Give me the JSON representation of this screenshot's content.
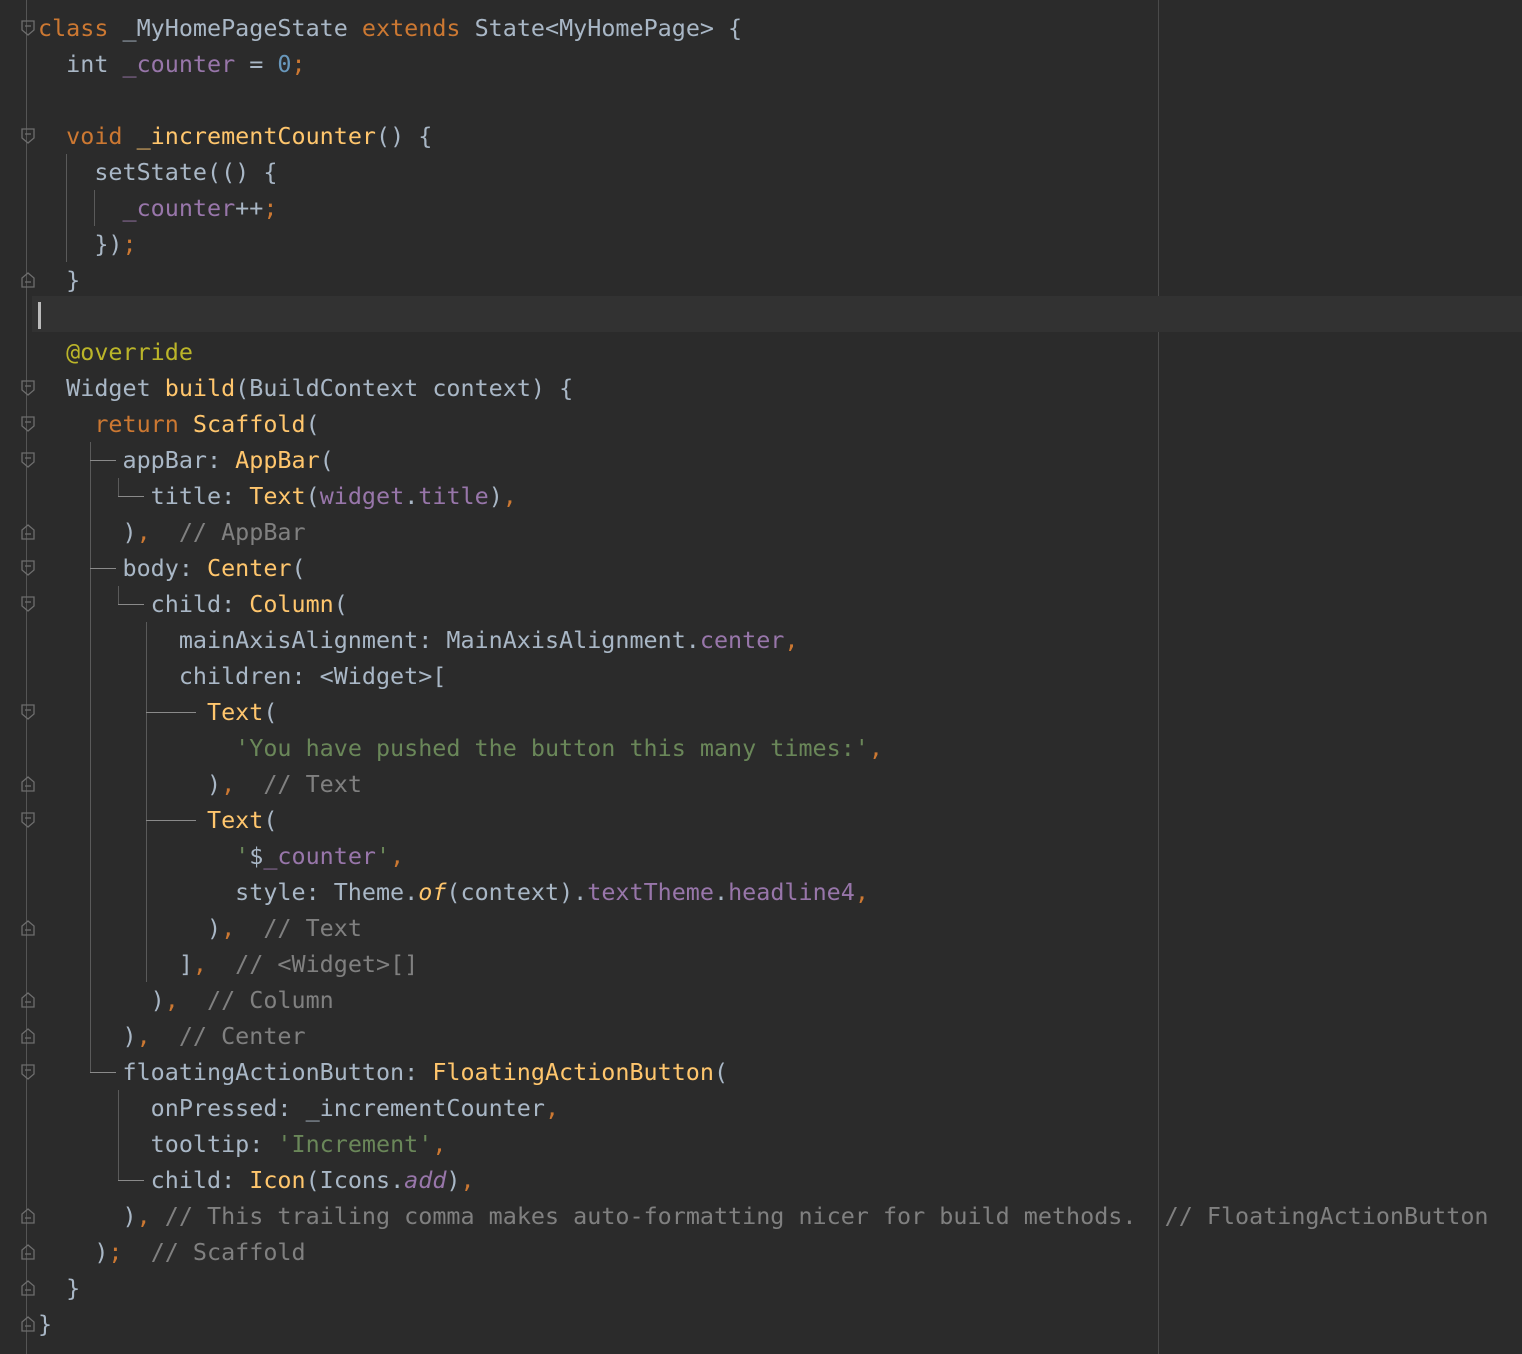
{
  "code_lines": [
    [
      {
        "t": "class ",
        "c": "kw"
      },
      {
        "t": "_MyHomePageState "
      },
      {
        "t": "extends ",
        "c": "kw"
      },
      {
        "t": "State<MyHomePage> {"
      }
    ],
    [
      {
        "t": "  int "
      },
      {
        "t": "_counter",
        "c": "field"
      },
      {
        "t": " = "
      },
      {
        "t": "0",
        "c": "num"
      },
      {
        "t": ";",
        "c": "punc"
      }
    ],
    [],
    [
      {
        "t": "  "
      },
      {
        "t": "void ",
        "c": "kw"
      },
      {
        "t": "_incrementCounter",
        "c": "fn"
      },
      {
        "t": "() {"
      }
    ],
    [
      {
        "t": "    setState(() {"
      }
    ],
    [
      {
        "t": "      "
      },
      {
        "t": "_counter",
        "c": "field"
      },
      {
        "t": "++"
      },
      {
        "t": ";",
        "c": "punc"
      }
    ],
    [
      {
        "t": "    })"
      },
      {
        "t": ";",
        "c": "punc"
      }
    ],
    [
      {
        "t": "  }"
      }
    ],
    [],
    [
      {
        "t": "  "
      },
      {
        "t": "@override",
        "c": "ann"
      }
    ],
    [
      {
        "t": "  Widget "
      },
      {
        "t": "build",
        "c": "fn"
      },
      {
        "t": "(BuildContext context) {"
      }
    ],
    [
      {
        "t": "    "
      },
      {
        "t": "return ",
        "c": "kw"
      },
      {
        "t": "Scaffold",
        "c": "fn"
      },
      {
        "t": "("
      }
    ],
    [
      {
        "t": "      appBar: "
      },
      {
        "t": "AppBar",
        "c": "fn"
      },
      {
        "t": "("
      }
    ],
    [
      {
        "t": "        title: "
      },
      {
        "t": "Text",
        "c": "fn"
      },
      {
        "t": "("
      },
      {
        "t": "widget",
        "c": "field"
      },
      {
        "t": "."
      },
      {
        "t": "title",
        "c": "field"
      },
      {
        "t": ")"
      },
      {
        "t": ",",
        "c": "punc"
      }
    ],
    [
      {
        "t": "      )"
      },
      {
        "t": ",",
        "c": "punc"
      },
      {
        "t": "  "
      },
      {
        "t": "// AppBar",
        "c": "cmt"
      }
    ],
    [
      {
        "t": "      body: "
      },
      {
        "t": "Center",
        "c": "fn"
      },
      {
        "t": "("
      }
    ],
    [
      {
        "t": "        child: "
      },
      {
        "t": "Column",
        "c": "fn"
      },
      {
        "t": "("
      }
    ],
    [
      {
        "t": "          mainAxisAlignment: MainAxisAlignment."
      },
      {
        "t": "center",
        "c": "field"
      },
      {
        "t": ",",
        "c": "punc"
      }
    ],
    [
      {
        "t": "          children: <Widget>["
      }
    ],
    [
      {
        "t": "            "
      },
      {
        "t": "Text",
        "c": "fn"
      },
      {
        "t": "("
      }
    ],
    [
      {
        "t": "              "
      },
      {
        "t": "'You have pushed the button this many times:'",
        "c": "str"
      },
      {
        "t": ",",
        "c": "punc"
      }
    ],
    [
      {
        "t": "            )"
      },
      {
        "t": ",",
        "c": "punc"
      },
      {
        "t": "  "
      },
      {
        "t": "// Text",
        "c": "cmt"
      }
    ],
    [
      {
        "t": "            "
      },
      {
        "t": "Text",
        "c": "fn"
      },
      {
        "t": "("
      }
    ],
    [
      {
        "t": "              "
      },
      {
        "t": "'",
        "c": "str"
      },
      {
        "t": "$"
      },
      {
        "t": "_counter",
        "c": "field"
      },
      {
        "t": "'",
        "c": "str"
      },
      {
        "t": ",",
        "c": "punc"
      }
    ],
    [
      {
        "t": "              style: Theme."
      },
      {
        "t": "of",
        "c": "fn it"
      },
      {
        "t": "(context)."
      },
      {
        "t": "textTheme",
        "c": "field"
      },
      {
        "t": "."
      },
      {
        "t": "headline4",
        "c": "field"
      },
      {
        "t": ",",
        "c": "punc"
      }
    ],
    [
      {
        "t": "            )"
      },
      {
        "t": ",",
        "c": "punc"
      },
      {
        "t": "  "
      },
      {
        "t": "// Text",
        "c": "cmt"
      }
    ],
    [
      {
        "t": "          ]"
      },
      {
        "t": ",",
        "c": "punc"
      },
      {
        "t": "  "
      },
      {
        "t": "// <Widget>[]",
        "c": "cmt"
      }
    ],
    [
      {
        "t": "        )"
      },
      {
        "t": ",",
        "c": "punc"
      },
      {
        "t": "  "
      },
      {
        "t": "// Column",
        "c": "cmt"
      }
    ],
    [
      {
        "t": "      )"
      },
      {
        "t": ",",
        "c": "punc"
      },
      {
        "t": "  "
      },
      {
        "t": "// Center",
        "c": "cmt"
      }
    ],
    [
      {
        "t": "      floatingActionButton: "
      },
      {
        "t": "FloatingActionButton",
        "c": "fn"
      },
      {
        "t": "("
      }
    ],
    [
      {
        "t": "        onPressed: _incrementCounter"
      },
      {
        "t": ",",
        "c": "punc"
      }
    ],
    [
      {
        "t": "        tooltip: "
      },
      {
        "t": "'Increment'",
        "c": "str"
      },
      {
        "t": ",",
        "c": "punc"
      }
    ],
    [
      {
        "t": "        child: "
      },
      {
        "t": "Icon",
        "c": "fn"
      },
      {
        "t": "(Icons."
      },
      {
        "t": "add",
        "c": "field it"
      },
      {
        "t": ")"
      },
      {
        "t": ",",
        "c": "punc"
      }
    ],
    [
      {
        "t": "      )"
      },
      {
        "t": ",",
        "c": "punc"
      },
      {
        "t": " "
      },
      {
        "t": "// This trailing comma makes auto-formatting nicer for build methods.  // FloatingActionButton",
        "c": "cmt"
      }
    ],
    [
      {
        "t": "    )"
      },
      {
        "t": ";",
        "c": "punc"
      },
      {
        "t": "  "
      },
      {
        "t": "// Scaffold",
        "c": "cmt"
      }
    ],
    [
      {
        "t": "  }"
      }
    ],
    [
      {
        "t": "}"
      }
    ]
  ],
  "fold_markers": [
    {
      "line": 0,
      "kind": "open"
    },
    {
      "line": 3,
      "kind": "open"
    },
    {
      "line": 7,
      "kind": "close"
    },
    {
      "line": 10,
      "kind": "open"
    },
    {
      "line": 11,
      "kind": "open"
    },
    {
      "line": 12,
      "kind": "open"
    },
    {
      "line": 14,
      "kind": "close"
    },
    {
      "line": 15,
      "kind": "open"
    },
    {
      "line": 16,
      "kind": "open"
    },
    {
      "line": 19,
      "kind": "open"
    },
    {
      "line": 21,
      "kind": "close"
    },
    {
      "line": 22,
      "kind": "open"
    },
    {
      "line": 25,
      "kind": "close"
    },
    {
      "line": 27,
      "kind": "close"
    },
    {
      "line": 28,
      "kind": "close"
    },
    {
      "line": 29,
      "kind": "open"
    },
    {
      "line": 33,
      "kind": "close"
    },
    {
      "line": 34,
      "kind": "close"
    },
    {
      "line": 35,
      "kind": "close"
    },
    {
      "line": 36,
      "kind": "close"
    }
  ],
  "caret_line": 8,
  "colors": {
    "background": "#2b2b2b",
    "text": "#a9b7c6",
    "keyword": "#cc7832",
    "field": "#9876aa",
    "number": "#6897bb",
    "function": "#ffc66d",
    "string": "#6a8759",
    "comment": "#808080",
    "annotation": "#bbb529"
  }
}
